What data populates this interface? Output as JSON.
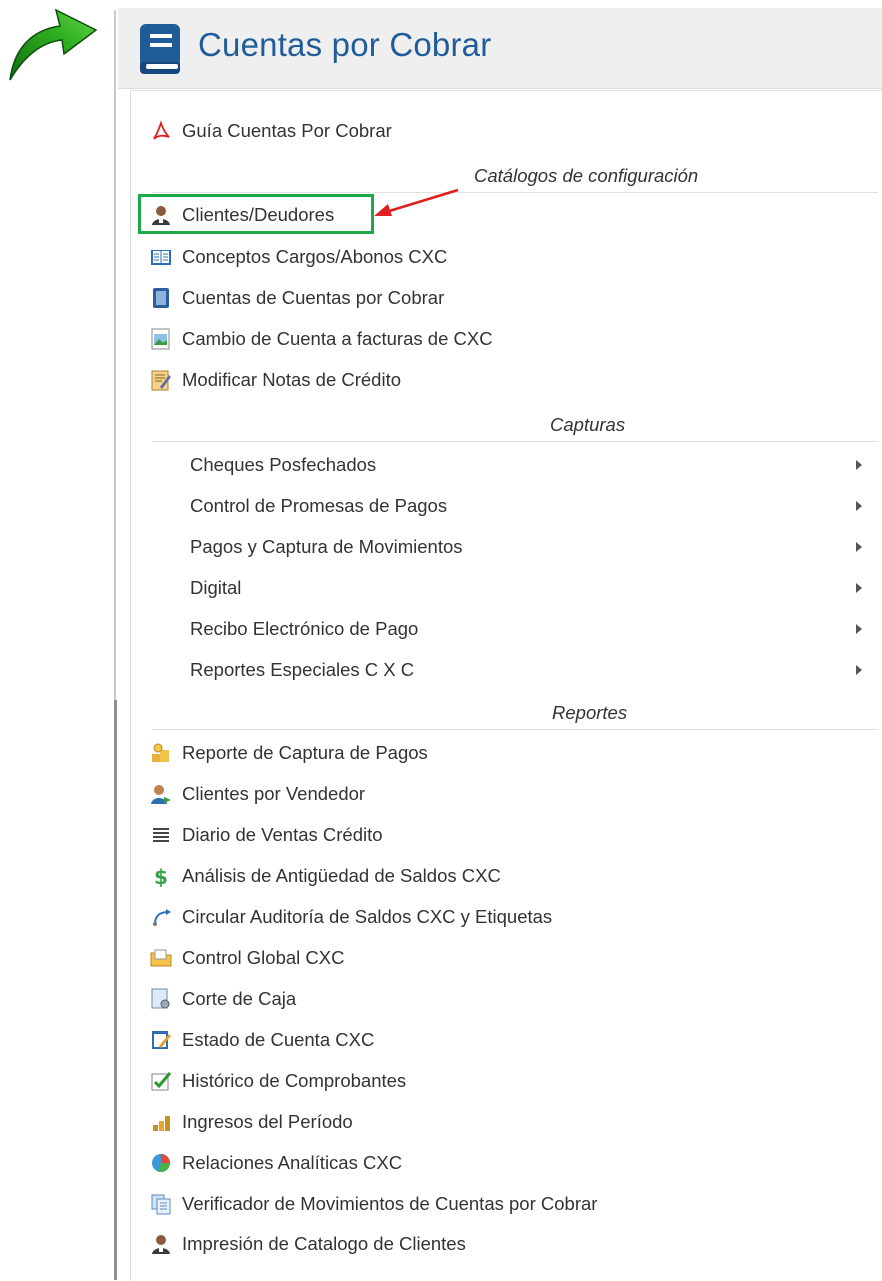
{
  "header": {
    "title": "Cuentas por Cobrar",
    "icon": "book-icon",
    "color": "#1f5c99"
  },
  "items_top": [
    {
      "label": "Guía Cuentas Por Cobrar",
      "icon": "pdf-icon"
    }
  ],
  "sections": {
    "catalogos": "Catálogos de configuración",
    "capturas": "Capturas",
    "reportes": "Reportes"
  },
  "catalogos": [
    {
      "label": "Clientes/Deudores",
      "icon": "user-icon"
    },
    {
      "label": "Conceptos Cargos/Abonos CXC",
      "icon": "open-book-icon"
    },
    {
      "label": "Cuentas de Cuentas por Cobrar",
      "icon": "ledger-icon"
    },
    {
      "label": "Cambio de Cuenta a facturas de CXC",
      "icon": "image-file-icon"
    },
    {
      "label": "Modificar Notas de Crédito",
      "icon": "edit-notes-icon"
    }
  ],
  "capturas": [
    {
      "label": "Cheques Posfechados"
    },
    {
      "label": "Control de Promesas de Pagos"
    },
    {
      "label": "Pagos y Captura de Movimientos"
    },
    {
      "label": "Digital"
    },
    {
      "label": "Recibo Electrónico de Pago"
    },
    {
      "label": "Reportes Especiales C X C"
    }
  ],
  "reportes": [
    {
      "label": "Reporte de Captura de Pagos",
      "icon": "coins-icon"
    },
    {
      "label": "Clientes por Vendedor",
      "icon": "user-transfer-icon"
    },
    {
      "label": "Diario de Ventas Crédito",
      "icon": "list-icon"
    },
    {
      "label": "Análisis de Antigüedad de Saldos CXC",
      "icon": "dollar-icon"
    },
    {
      "label": "Circular Auditoría de Saldos CXC y Etiquetas",
      "icon": "circular-arrow-icon"
    },
    {
      "label": "Control Global CXC",
      "icon": "folder-icon"
    },
    {
      "label": "Corte de Caja",
      "icon": "document-gear-icon"
    },
    {
      "label": "Estado de Cuenta CXC",
      "icon": "document-edit-icon"
    },
    {
      "label": "Histórico de Comprobantes",
      "icon": "checkbox-icon"
    },
    {
      "label": "Ingresos del Período",
      "icon": "coin-stack-icon"
    },
    {
      "label": "Relaciones Analíticas CXC",
      "icon": "pie-chart-icon"
    },
    {
      "label": "Verificador de Movimientos de Cuentas por Cobrar",
      "icon": "documents-icon"
    },
    {
      "label": "Impresión de Catalogo de Clientes",
      "icon": "user-icon"
    }
  ],
  "annotation": {
    "highlight_color": "#1ea84a",
    "arrow_color": "#e02020",
    "green_arrow_color": "#2a9d1f"
  }
}
